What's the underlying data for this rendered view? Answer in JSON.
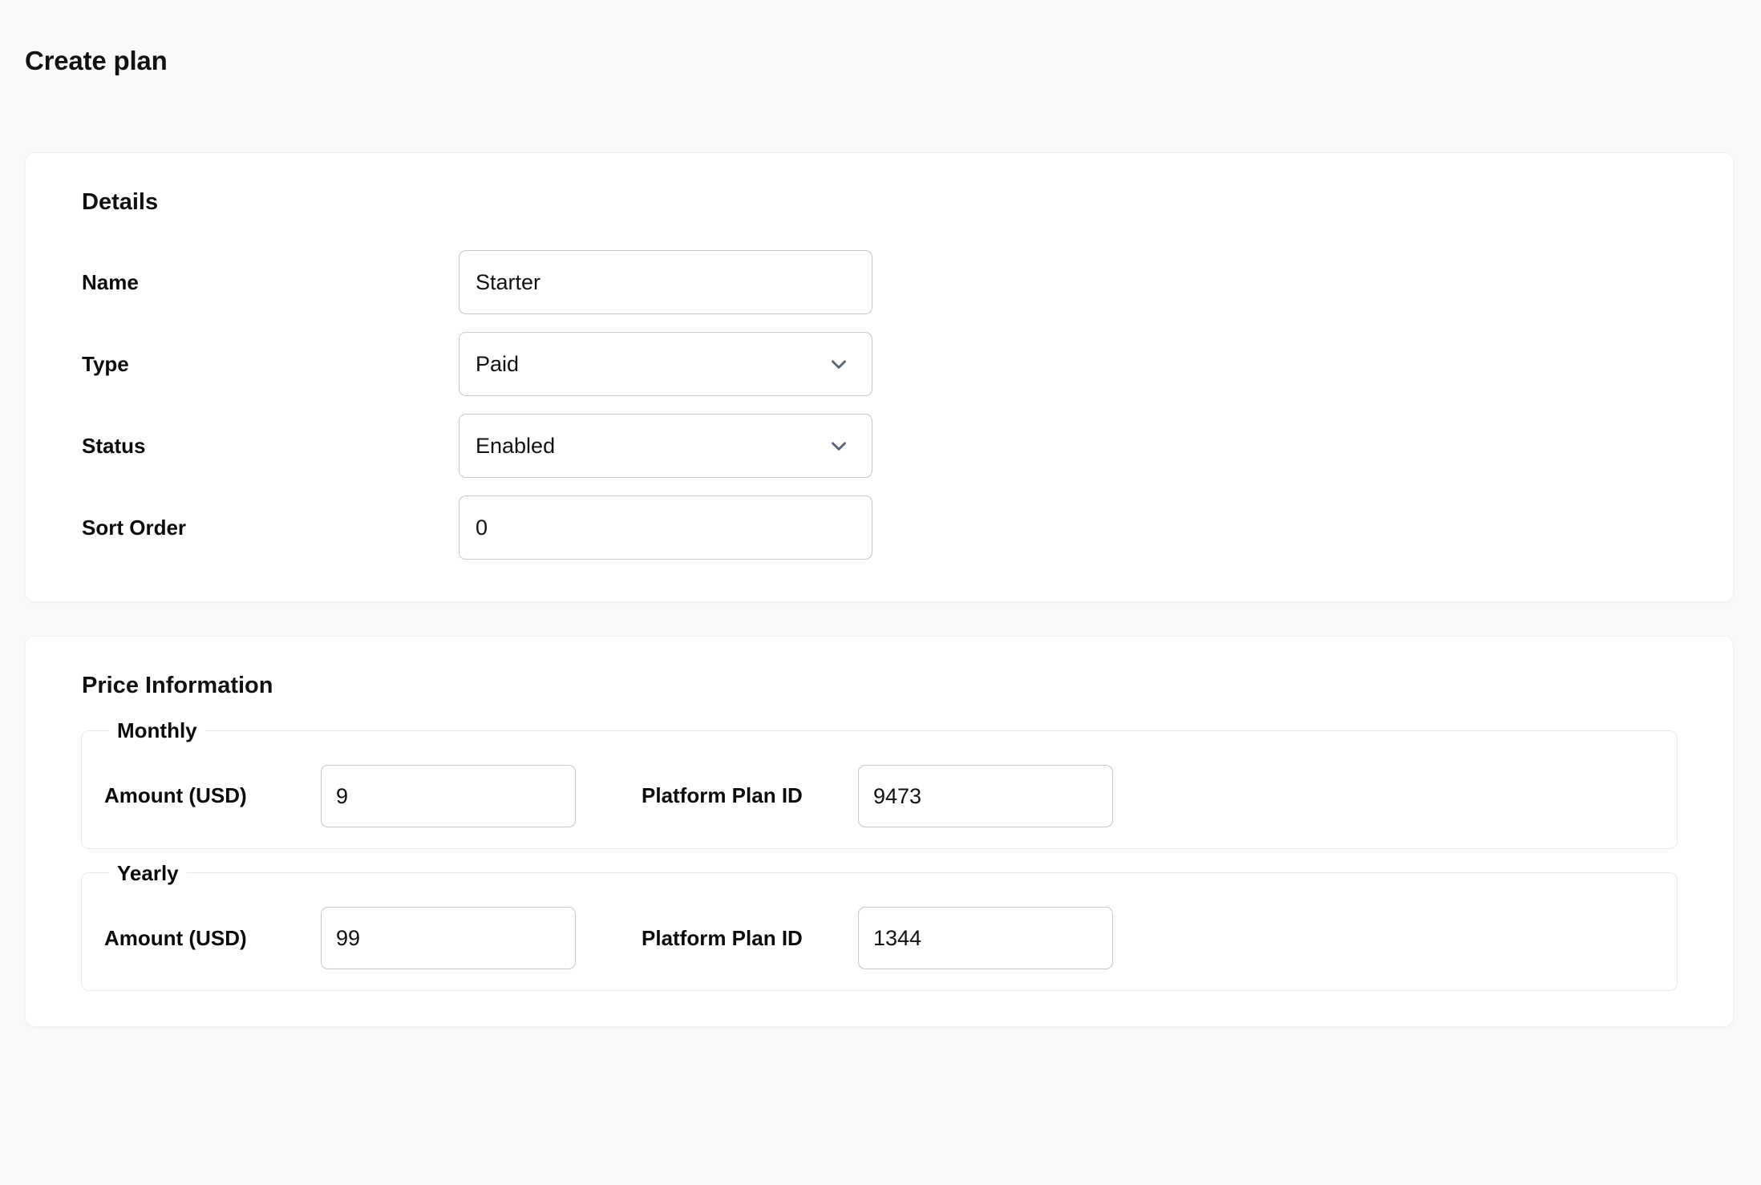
{
  "page": {
    "title": "Create plan",
    "background_color": "#f8f9fa",
    "card_background_color": "#ffffff"
  },
  "details": {
    "section_title": "Details",
    "fields": {
      "name": {
        "label": "Name",
        "value": "Starter",
        "type": "text"
      },
      "type": {
        "label": "Type",
        "value": "Paid",
        "type": "select",
        "icon": "chevron-down-icon"
      },
      "status": {
        "label": "Status",
        "value": "Enabled",
        "type": "select",
        "icon": "chevron-down-icon"
      },
      "sort_order": {
        "label": "Sort Order",
        "value": "0",
        "type": "text"
      }
    }
  },
  "price_information": {
    "section_title": "Price Information",
    "groups": [
      {
        "legend": "Monthly",
        "amount_label": "Amount (USD)",
        "amount_value": "9",
        "plan_id_label": "Platform Plan ID",
        "plan_id_value": "9473"
      },
      {
        "legend": "Yearly",
        "amount_label": "Amount (USD)",
        "amount_value": "99",
        "plan_id_label": "Platform Plan ID",
        "plan_id_value": "1344"
      }
    ]
  },
  "colors": {
    "text": "#111111",
    "input_border": "#c8c8cc",
    "fieldset_border": "#e8e9ed",
    "chevron": "#5a6472"
  }
}
